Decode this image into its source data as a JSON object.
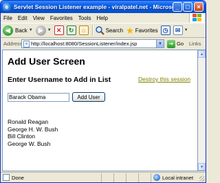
{
  "window": {
    "title": "Servlet Session Listener example - viralpatel.net - Microsoft I..."
  },
  "menu": {
    "items": [
      "File",
      "Edit",
      "View",
      "Favorites",
      "Tools",
      "Help"
    ]
  },
  "toolbar": {
    "back_label": "Back",
    "search_label": "Search",
    "favorites_label": "Favorites"
  },
  "address": {
    "label": "Address",
    "url": "http://localhost:8080/SessionListener/index.jsp",
    "go_label": "Go",
    "links_label": "Links"
  },
  "page": {
    "title": "Add User Screen",
    "subtitle": "Enter Username to Add in List",
    "destroy_link": "Destroy this session",
    "username_value": "Barack Obama",
    "add_button": "Add User",
    "users": [
      "Ronald Reagan",
      "George H. W. Bush",
      "Bill Clinton",
      "George W. Bush"
    ]
  },
  "status": {
    "text": "Done",
    "zone": "Local intranet"
  }
}
